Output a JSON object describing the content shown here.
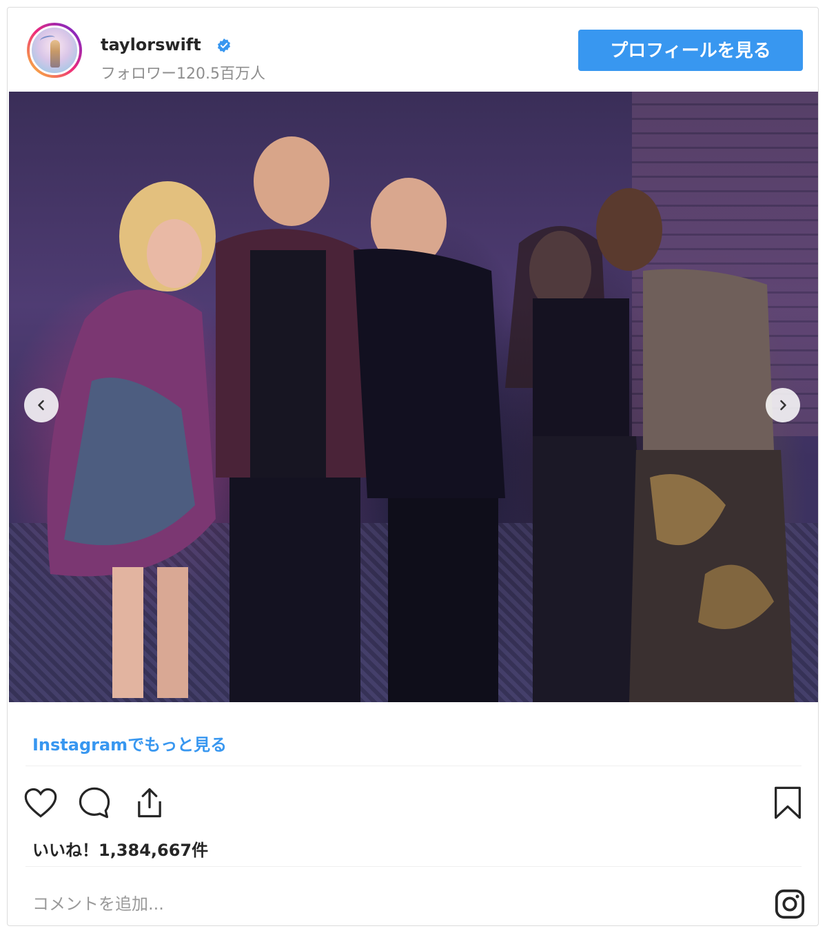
{
  "header": {
    "username": "taylorswift",
    "followers": "フォロワー120.5百万人",
    "profile_button": "プロフィールを見る",
    "verified_icon": "verified-badge-icon"
  },
  "post": {
    "image_alt": "",
    "more_link": "Instagramでもっと見る",
    "likes": "いいね！1,384,667件",
    "comment_placeholder": "コメントを追加...",
    "icons": [
      "heart-icon",
      "comment-icon",
      "share-icon",
      "bookmark-icon",
      "instagram-logo-icon",
      "chevron-left-icon",
      "chevron-right-icon"
    ]
  },
  "colors": {
    "accent": "#3897f0",
    "text": "#262626",
    "muted": "#8e8e8e",
    "border": "#dbdbdb"
  }
}
